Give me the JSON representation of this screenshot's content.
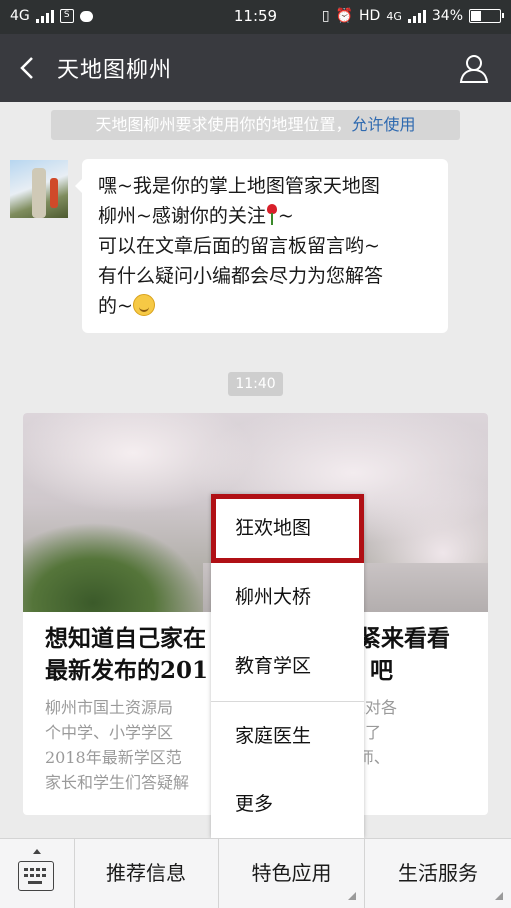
{
  "status_bar": {
    "network_left": "4G",
    "time": "11:59",
    "hd": "HD",
    "network_right": "4G",
    "battery": "34%"
  },
  "nav": {
    "title": "天地图柳州",
    "back_icon": "back-arrow-icon",
    "profile_icon": "user-profile-icon"
  },
  "location_notice": {
    "text": "天地图柳州要求使用你的地理位置，",
    "link": "允许使用"
  },
  "welcome_message": {
    "lines": [
      "嘿~我是你的掌上地图管家天地图",
      "柳州~感谢你的关注",
      "可以在文章后面的留言板留言哟~",
      "有什么疑问小编都会尽力为您解答",
      "的~"
    ],
    "line2_suffix": "~"
  },
  "timestamp": "11:40",
  "article_card": {
    "title_lines": [
      "想知道自己家在",
      "紧来看看",
      "最新发布的201",
      "吧"
    ],
    "desc_lines": [
      "柳州市国土资源局",
      "，通过对各",
      "个中学、小学学区",
      "作并发布了",
      "2018年最新学区范",
      "地为老师、",
      "家长和学生们答疑解"
    ]
  },
  "popup_menu": {
    "items": [
      "狂欢地图",
      "柳州大桥",
      "教育学区",
      "家庭医生",
      "更多"
    ],
    "highlighted_index": 0
  },
  "tab_bar": {
    "keyboard_icon": "keyboard-icon",
    "tabs": [
      "推荐信息",
      "特色应用",
      "生活服务"
    ]
  }
}
